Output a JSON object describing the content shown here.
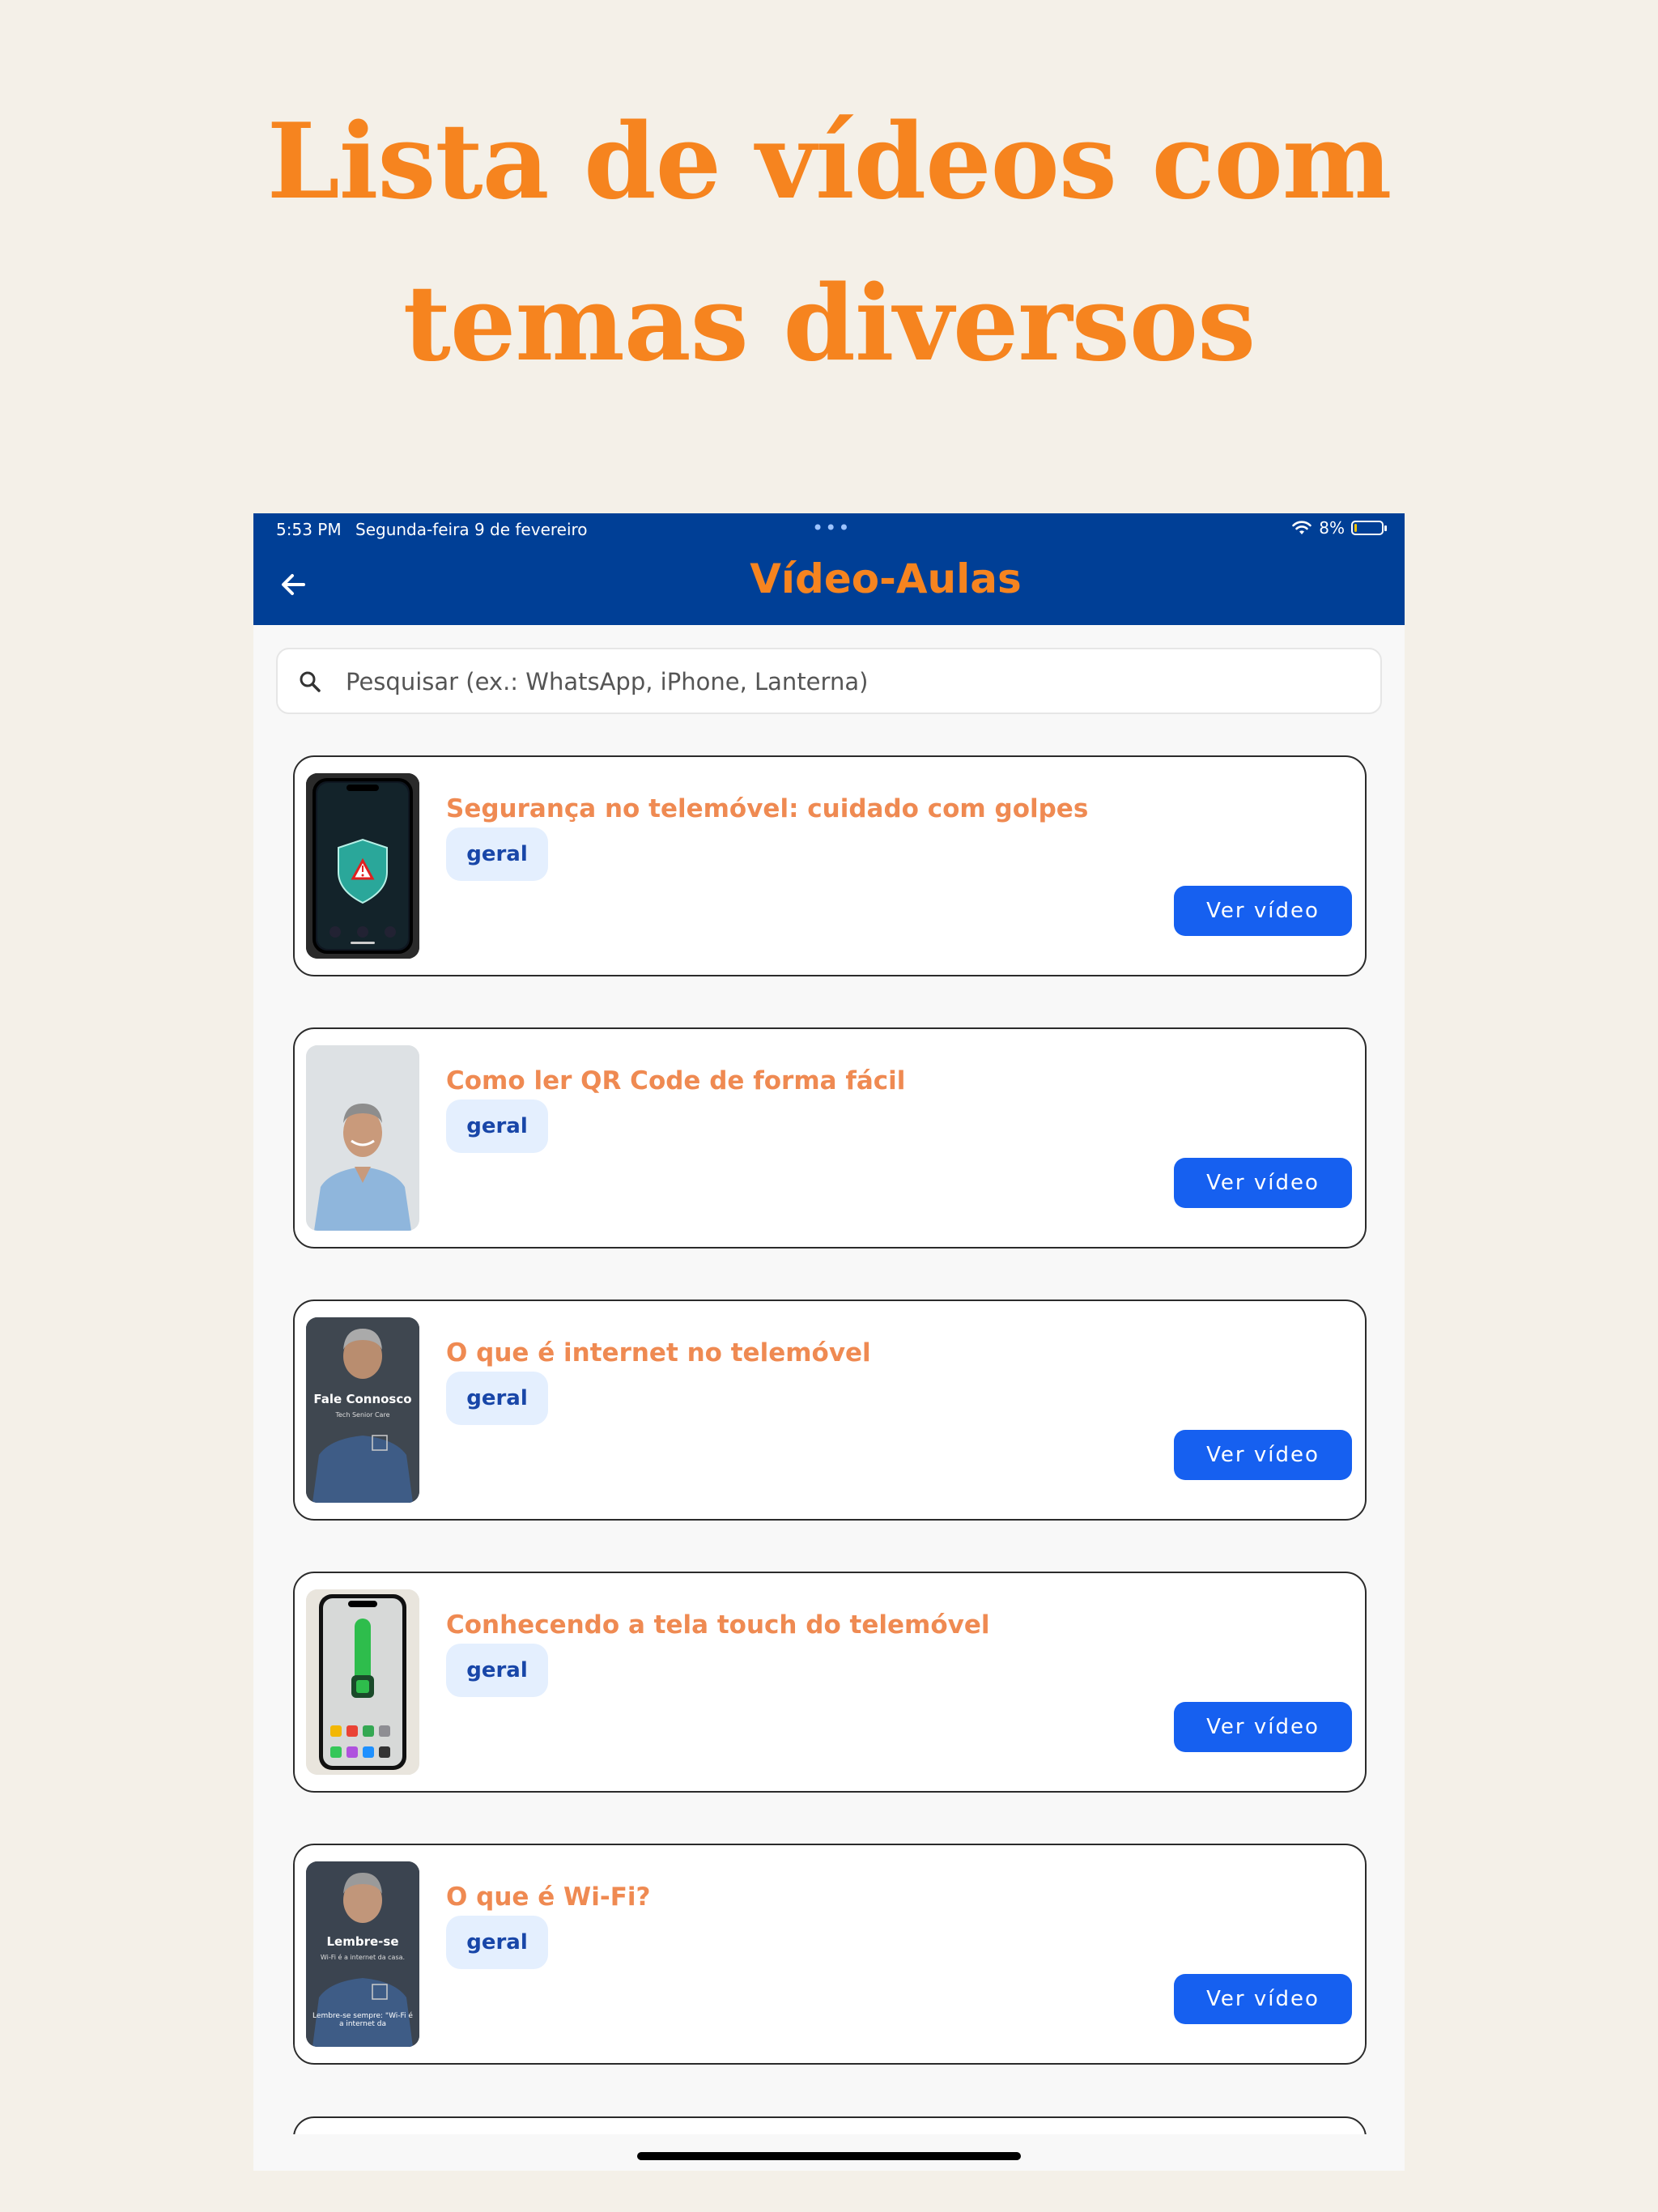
{
  "headline": {
    "line1": "Lista de vídeos com",
    "line2": "temas diversos"
  },
  "status_bar": {
    "time": "5:53 PM",
    "date": "Segunda-feira 9 de fevereiro",
    "dots": "•••",
    "battery": "8%",
    "battery_level": 0.08
  },
  "appbar": {
    "title": "Vídeo-Aulas"
  },
  "search": {
    "placeholder": "Pesquisar (ex.: WhatsApp, iPhone, Lanterna)"
  },
  "videos": [
    {
      "title": "Segurança no telemóvel: cuidado com golpes",
      "tag": "geral",
      "button": "Ver vídeo"
    },
    {
      "title": "Como ler QR Code de forma fácil",
      "tag": "geral",
      "button": "Ver vídeo"
    },
    {
      "title": "O que é internet no telemóvel",
      "tag": "geral",
      "button": "Ver vídeo",
      "thumb_caption": "Fale Connosco",
      "thumb_subcaption": "Tech Senior Care"
    },
    {
      "title": "Conhecendo a tela touch do telemóvel",
      "tag": "geral",
      "button": "Ver vídeo"
    },
    {
      "title": "O que é Wi-Fi?",
      "tag": "geral",
      "button": "Ver vídeo",
      "thumb_caption": "Lembre-se",
      "thumb_subcaption": "Wi-Fi é a internet da casa.",
      "thumb_footer": "Lembre-se sempre: \"Wi-Fi é a internet da"
    }
  ],
  "colors": {
    "accent": "#f6841f",
    "appbar": "#003f96",
    "button": "#1660f0",
    "card_title": "#ef8a52",
    "tag_bg": "#e4effe",
    "tag_text": "#1846a8",
    "page_bg": "#f4f0e8"
  }
}
